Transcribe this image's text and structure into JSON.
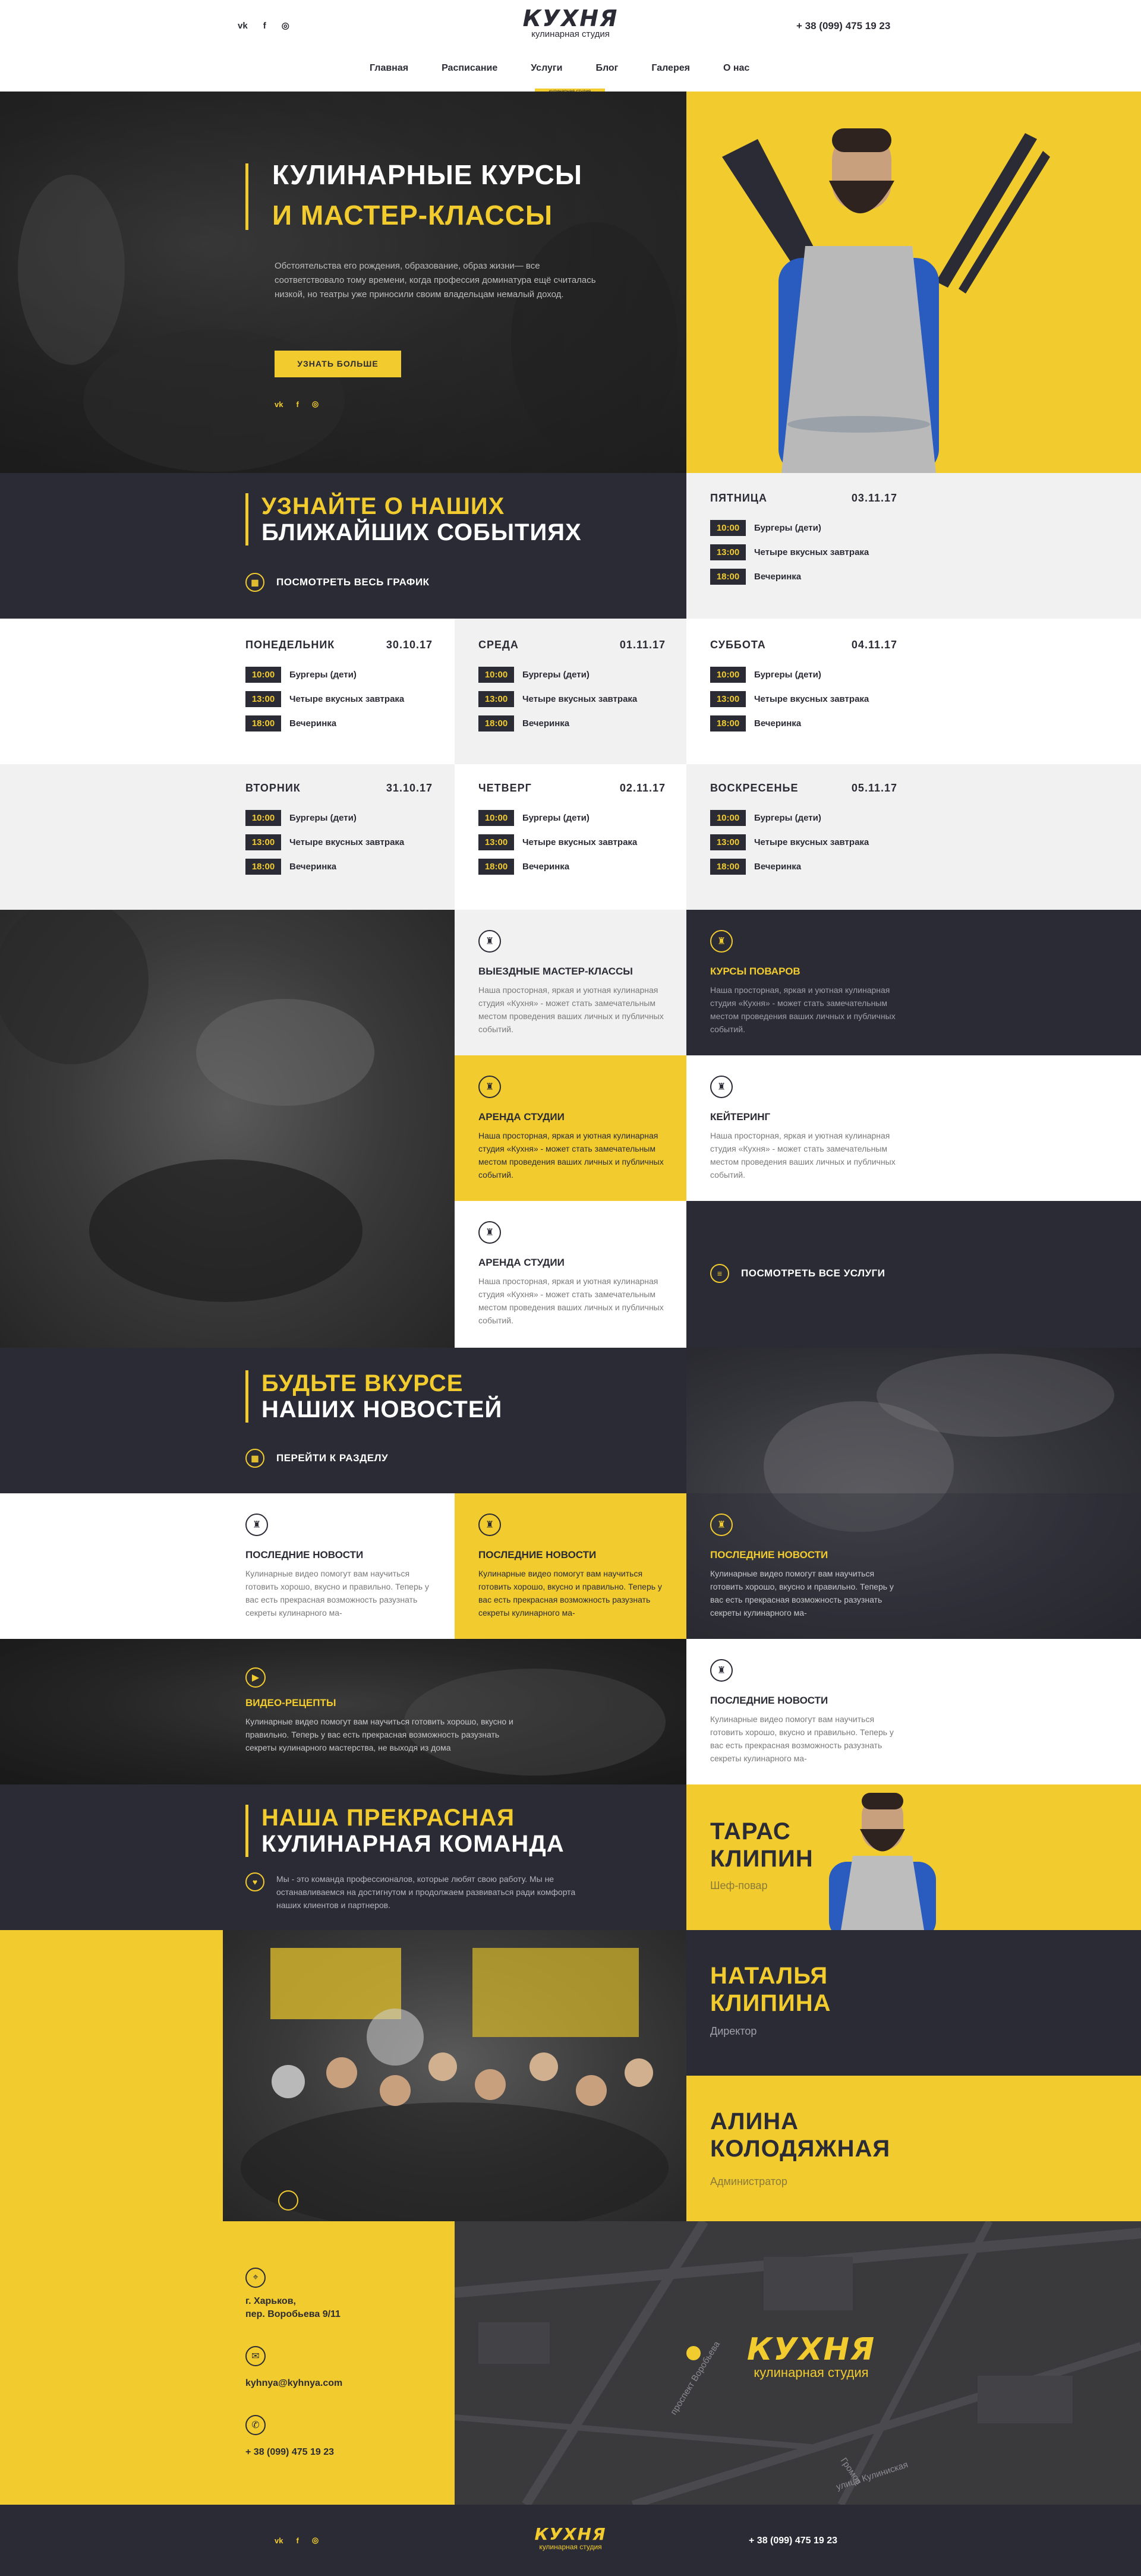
{
  "header": {
    "social": [
      "vk",
      "f",
      "◎"
    ],
    "logo": "КУХНЯ",
    "logo_sub": "кулинарная студия",
    "phone": "+ 38 (099) 475 19 23",
    "nav": [
      "Главная",
      "Расписание",
      "Услуги",
      "Блог",
      "Галерея",
      "О нас"
    ],
    "nav_under": "кулинарная студия"
  },
  "hero": {
    "title_line1": "КУЛИНАРНЫЕ КУРСЫ",
    "title_line2": "И МАСТЕР-КЛАССЫ",
    "text": "Обстоятельства его рождения, образование, образ жизни— все соответствовало тому времени, когда профессия доминатура ещё считалась низкой, но театры уже приносили своим владельцам немалый доход.",
    "button": "УЗНАТЬ БОЛЬШЕ"
  },
  "events": {
    "title_line1": "УЗНАЙТЕ О НАШИХ",
    "title_line2": "БЛИЖАЙШИХ СОБЫТИЯХ",
    "link": "ПОСМОТРЕТЬ ВЕСЬ ГРАФИК",
    "days": [
      {
        "day": "ПЯТНИЦА",
        "date": "03.11.17"
      },
      {
        "day": "ПОНЕДЕЛЬНИК",
        "date": "30.10.17"
      },
      {
        "day": "СРЕДА",
        "date": "01.11.17"
      },
      {
        "day": "СУББОТА",
        "date": "04.11.17"
      },
      {
        "day": "ВТОРНИК",
        "date": "31.10.17"
      },
      {
        "day": "ЧЕТВЕРГ",
        "date": "02.11.17"
      },
      {
        "day": "ВОСКРЕСЕНЬЕ",
        "date": "05.11.17"
      }
    ],
    "items": [
      {
        "time": "10:00",
        "name": "Бургеры (дети)"
      },
      {
        "time": "13:00",
        "name": "Четыре вкусных завтрака"
      },
      {
        "time": "18:00",
        "name": "Вечеринка"
      }
    ]
  },
  "services": {
    "cards": [
      {
        "title": "ВЫЕЗДНЫЕ МАСТЕР-КЛАССЫ",
        "text": "Наша просторная, яркая и уютная кулинарная студия «Кухня» - может стать замечательным местом проведения ваших личных и публичных событий."
      },
      {
        "title": "КУРСЫ ПОВАРОВ",
        "text": "Наша просторная, яркая и уютная кулинарная студия «Кухня» - может стать замечательным местом проведения ваших личных и публичных событий."
      },
      {
        "title": "АРЕНДА СТУДИИ",
        "text": "Наша просторная, яркая и уютная кулинарная студия «Кухня» - может стать замечательным местом проведения ваших личных и публичных событий."
      },
      {
        "title": "КЕЙТЕРИНГ",
        "text": "Наша просторная, яркая и уютная кулинарная студия «Кухня» - может стать замечательным местом проведения ваших личных и публичных событий."
      },
      {
        "title": "АРЕНДА СТУДИИ",
        "text": "Наша просторная, яркая и уютная кулинарная студия «Кухня» - может стать замечательным местом проведения ваших личных и публичных событий."
      }
    ],
    "all_link": "ПОСМОТРЕТЬ ВСЕ УСЛУГИ"
  },
  "news": {
    "title_line1": "БУДЬТЕ ВКУРСЕ",
    "title_line2": "НАШИХ НОВОСТЕЙ",
    "link": "ПЕРЕЙТИ К РАЗДЕЛУ",
    "card_title": "ПОСЛЕДНИЕ НОВОСТИ",
    "card_text": "Кулинарные видео помогут вам научиться готовить хорошо, вкусно и правильно. Теперь у вас есть прекрасная возможность разузнать секреты кулинарного ма-",
    "video_title": "ВИДЕО-РЕЦЕПТЫ",
    "video_text": "Кулинарные видео помогут вам научиться готовить хорошо, вкусно и правильно. Теперь у вас есть прекрасная возможность разузнать секреты кулинарного мастерства, не выходя из дома"
  },
  "team": {
    "title_line1": "НАША ПРЕКРАСНАЯ",
    "title_line2": "КУЛИНАРНАЯ КОМАНДА",
    "text": "Мы - это команда профессионалов, которые любят свою работу. Мы не останавливаемся на достигнутом и продолжаем развиваться ради комфорта наших клиентов и партнеров.",
    "members": [
      {
        "name1": "ТАРАС",
        "name2": "КЛИПИН",
        "role": "Шеф-повар"
      },
      {
        "name1": "НАТАЛЬЯ",
        "name2": "КЛИПИНА",
        "role": "Директор"
      },
      {
        "name1": "АЛИНА",
        "name2": "КОЛОДЯЖНАЯ",
        "role": "Администратор"
      }
    ]
  },
  "contacts": {
    "city": "г. Харьков,",
    "address": "пер. Воробьева 9/11",
    "email": "kyhnya@kyhnya.com",
    "phone": "+ 38 (099) 475 19 23",
    "map_streets": [
      "проспект Воробьева",
      "улица Кулиниская",
      "Громов"
    ]
  },
  "footer": {
    "social": [
      "vk",
      "f",
      "◎"
    ],
    "logo": "КУХНЯ",
    "logo_sub": "кулинарная студия",
    "phone": "+ 38 (099) 475 19 23"
  },
  "colors": {
    "accent": "#f2cc2e",
    "dark": "#2b2b36",
    "light": "#f1f1f1"
  }
}
